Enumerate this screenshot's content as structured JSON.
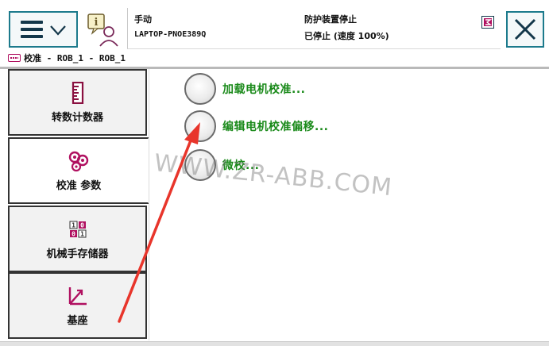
{
  "header": {
    "mode": "手动",
    "controller_name": "LAPTOP-PNOE389Q",
    "safety_state": "防护装置停止",
    "run_state": "已停止 (速度 100%)"
  },
  "breadcrumb": {
    "text": "校准 - ROB_1 - ROB_1"
  },
  "sidebar": {
    "items": [
      {
        "label": "转数计数器",
        "icon": "revolution-counter-icon"
      },
      {
        "label": "校准 参数",
        "icon": "calibration-parameters-icon"
      },
      {
        "label": "机械手存储器",
        "icon": "memory-icon"
      },
      {
        "label": "基座",
        "icon": "base-frame-icon"
      }
    ],
    "active_index": 1
  },
  "main": {
    "options": [
      {
        "label": "加载电机校准..."
      },
      {
        "label": "编辑电机校准偏移..."
      },
      {
        "label": "微校..."
      }
    ]
  },
  "watermark": {
    "text": "WWW.ZR-ABB.COM"
  },
  "colors": {
    "accent": "#1c7a8c",
    "option_text": "#1a8a1a",
    "icon_magenta": "#b01060",
    "annotation_arrow": "#e8352b"
  }
}
